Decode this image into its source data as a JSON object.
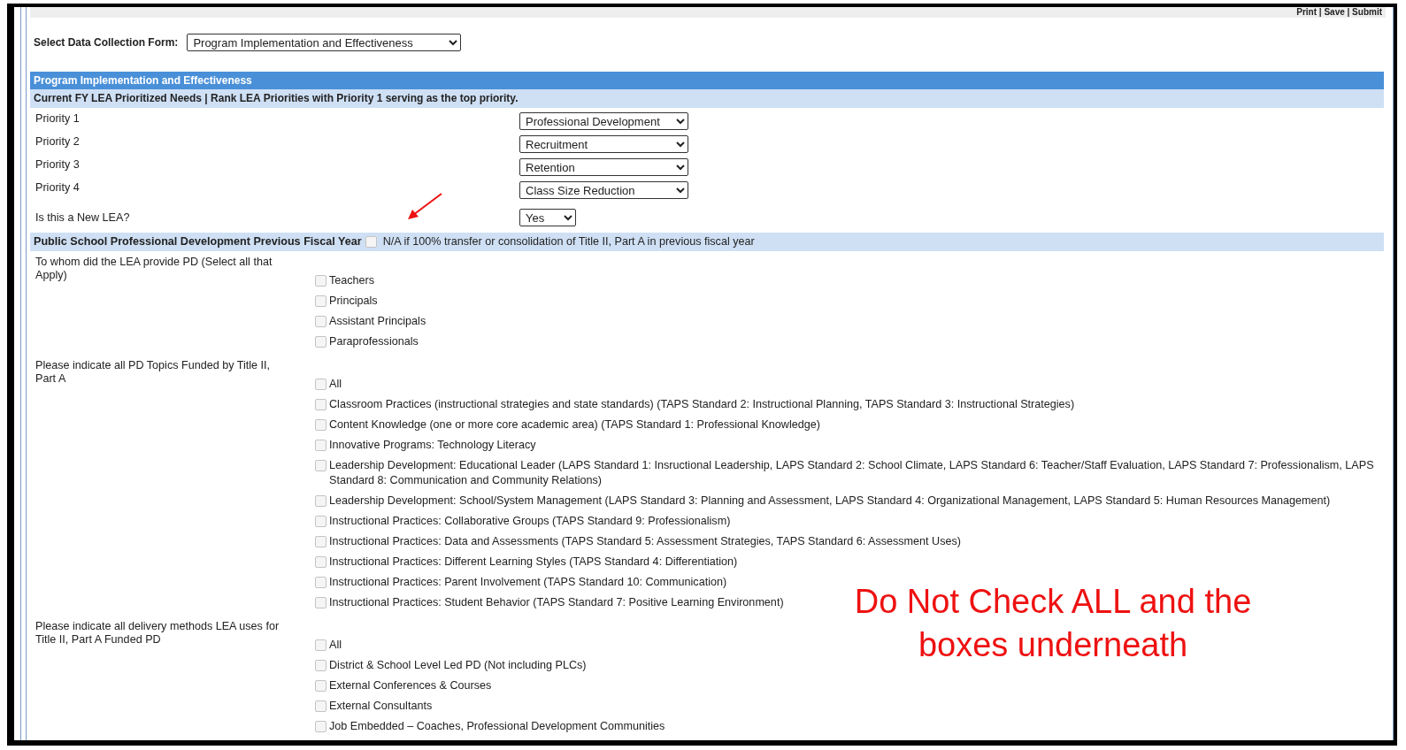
{
  "top_links": "Print | Save | Submit",
  "form_select": {
    "label": "Select Data Collection Form:",
    "value": "Program Implementation and Effectiveness"
  },
  "section_title": "Program Implementation and Effectiveness",
  "priorities_header": "Current FY LEA Prioritized Needs | Rank LEA Priorities with Priority 1 serving as the top priority.",
  "priorities": [
    {
      "label": "Priority 1",
      "value": "Professional Development"
    },
    {
      "label": "Priority 2",
      "value": "Recruitment"
    },
    {
      "label": "Priority 3",
      "value": "Retention"
    },
    {
      "label": "Priority 4",
      "value": "Class Size Reduction"
    }
  ],
  "new_lea": {
    "label": "Is this a New LEA?",
    "value": "Yes"
  },
  "pd_header": {
    "title": "Public School Professional Development Previous Fiscal Year",
    "na_checked": false,
    "na_label": "N/A if 100% transfer or consolidation of Title II, Part A in previous fiscal year"
  },
  "groups": [
    {
      "question": "To whom did the LEA provide PD (Select all that Apply)",
      "options": [
        {
          "label": "Teachers",
          "checked": false
        },
        {
          "label": "Principals",
          "checked": false
        },
        {
          "label": "Assistant Principals",
          "checked": false
        },
        {
          "label": "Paraprofessionals",
          "checked": false
        }
      ]
    },
    {
      "question": "Please indicate all PD Topics Funded by Title II, Part A",
      "options": [
        {
          "label": "All",
          "checked": false
        },
        {
          "label": "Classroom Practices (instructional strategies and state standards) (TAPS Standard 2: Instructional Planning, TAPS Standard 3: Instructional Strategies)",
          "checked": false
        },
        {
          "label": "Content Knowledge (one or more core academic area) (TAPS Standard 1: Professional Knowledge)",
          "checked": false
        },
        {
          "label": "Innovative Programs: Technology Literacy",
          "checked": false
        },
        {
          "label": "Leadership Development: Educational Leader (LAPS Standard 1: Insructional Leadership, LAPS Standard 2: School Climate, LAPS Standard 6: Teacher/Staff Evaluation, LAPS Standard 7: Professionalism, LAPS Standard 8: Communication and Community Relations)",
          "checked": false
        },
        {
          "label": "Leadership Development: School/System Management (LAPS Standard 3: Planning and Assessment, LAPS Standard 4: Organizational Management, LAPS Standard 5: Human Resources Management)",
          "checked": false
        },
        {
          "label": "Instructional Practices: Collaborative Groups (TAPS Standard 9: Professionalism)",
          "checked": false
        },
        {
          "label": "Instructional Practices: Data and Assessments (TAPS Standard 5: Assessment Strategies, TAPS Standard 6: Assessment Uses)",
          "checked": false
        },
        {
          "label": "Instructional Practices: Different Learning Styles (TAPS Standard 4: Differentiation)",
          "checked": false
        },
        {
          "label": "Instructional Practices: Parent Involvement (TAPS Standard 10: Communication)",
          "checked": false
        },
        {
          "label": "Instructional Practices: Student Behavior (TAPS Standard 7: Positive Learning Environment)",
          "checked": false
        }
      ]
    },
    {
      "question": "Please indicate all delivery methods LEA uses for Title II, Part A Funded PD",
      "options": [
        {
          "label": "All",
          "checked": false
        },
        {
          "label": "District & School Level Led PD (Not including PLCs)",
          "checked": false
        },
        {
          "label": "External Conferences & Courses",
          "checked": false
        },
        {
          "label": "External Consultants",
          "checked": false
        },
        {
          "label": "Job Embedded – Coaches, Professional Development Communities",
          "checked": false
        }
      ]
    }
  ],
  "annotation": "Do Not Check ALL and the boxes underneath"
}
